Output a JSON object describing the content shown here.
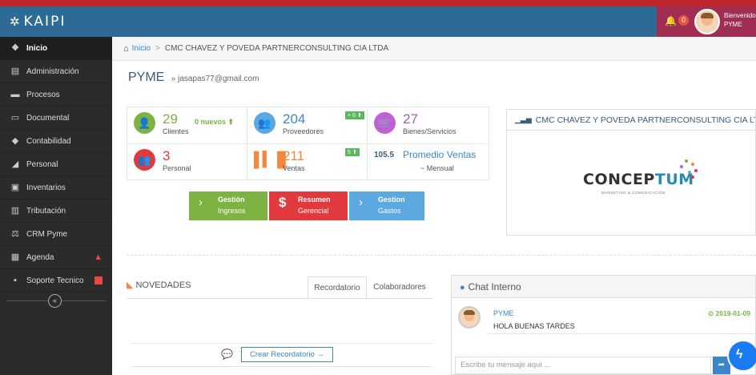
{
  "app": {
    "logo": "KAIPI",
    "notifications": "0",
    "welcome_line1": "Bienvenido,",
    "welcome_line2": "PYME"
  },
  "sidebar": {
    "items": [
      {
        "label": "Inicio",
        "icon": "dashboard-icon",
        "active": true
      },
      {
        "label": "Administración",
        "icon": "list-icon"
      },
      {
        "label": "Procesos",
        "icon": "folder-icon"
      },
      {
        "label": "Documental",
        "icon": "monitor-icon"
      },
      {
        "label": "Contabilidad",
        "icon": "tag-icon"
      },
      {
        "label": "Personal",
        "icon": "chart-icon"
      },
      {
        "label": "Inventarios",
        "icon": "image-icon"
      },
      {
        "label": "Tributación",
        "icon": "barcode-icon"
      },
      {
        "label": "CRM Pyme",
        "icon": "balance-icon"
      },
      {
        "label": "Agenda",
        "icon": "calendar-icon"
      },
      {
        "label": "Soporte Tecnico",
        "icon": "support-icon"
      }
    ],
    "collapse_symbol": "«"
  },
  "breadcrumb": {
    "home": "Inicio",
    "current": "CMC CHAVEZ Y POVEDA PARTNERCONSULTING CIA LTDA"
  },
  "header": {
    "title": "PYME",
    "subtitle": "» jasapas77@gmail.com"
  },
  "stats": {
    "clientes": {
      "value": "29",
      "label": "Clientes",
      "extra": "0 nuevos"
    },
    "proveedores": {
      "value": "204",
      "label": "Proveedores",
      "badge": "+ 0"
    },
    "bienes": {
      "value": "27",
      "label": "Bienes/Servicios"
    },
    "personal": {
      "value": "3",
      "label": "Personal"
    },
    "ventas": {
      "value": "211",
      "label": "Ventas",
      "badge": "5"
    },
    "promedio": {
      "value": "105.5",
      "label": "Promedio Ventas",
      "sub": "~ Mensual"
    }
  },
  "gestion": [
    {
      "title": "Gestión",
      "sub": "Ingresos",
      "color": "#7cb342"
    },
    {
      "title": "Resumen",
      "sub": "Gerencial",
      "color": "#e0393e"
    },
    {
      "title": "Gestion",
      "sub": "Gastos",
      "color": "#5ba9e0"
    }
  ],
  "company": {
    "title": "CMC CHAVEZ Y POVEDA PARTNERCONSULTING CIA LTDA",
    "logo_text_a": "CONCEP",
    "logo_text_b": "TUM",
    "logo_sub": "MARKETING & COMUNICACIÓN"
  },
  "novedades": {
    "title": "NOVEDADES",
    "tabs": [
      "Recordatorio",
      "Colaboradores"
    ],
    "create_button": "Crear Recordatorio"
  },
  "chat": {
    "title": "Chat Interno",
    "messages": [
      {
        "name": "PYME",
        "date": "2019-01-09",
        "text": "HOLA BUENAS TARDES"
      }
    ],
    "input_placeholder": "Escribe tu mensaje aquí ..."
  }
}
